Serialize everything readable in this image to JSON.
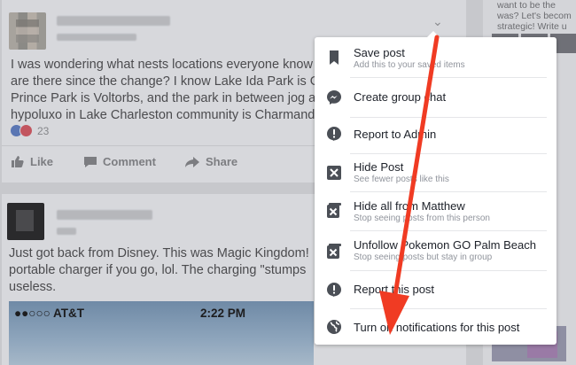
{
  "post1": {
    "text_lines": [
      "I was wondering what nests locations everyone know",
      "are there since the change? I know Lake Ida Park is G",
      "Prince Park is Voltorbs, and the park in between jog a",
      "hypoluxo in Lake Charleston community is Charmand"
    ],
    "reaction_count": "23",
    "actions": {
      "like": "Like",
      "comment": "Comment",
      "share": "Share"
    }
  },
  "post2": {
    "text_lines": [
      "Just got back from Disney. This was Magic Kingdom!",
      "portable charger if you go, lol. The charging \"stumps",
      "useless."
    ],
    "phone_status": {
      "carrier": "●●○○○ AT&T",
      "time": "2:22 PM"
    }
  },
  "rail": {
    "text_lines": [
      "want to be the",
      "was? Let's becom",
      "strategic! Write u"
    ]
  },
  "menu": {
    "items": [
      {
        "title": "Save post",
        "subtitle": "Add this to your saved items",
        "icon": "bookmark-icon"
      },
      {
        "title": "Create group chat",
        "subtitle": "",
        "icon": "messenger-icon"
      },
      {
        "title": "Report to Admin",
        "subtitle": "",
        "icon": "alert-icon"
      },
      {
        "title": "Hide Post",
        "subtitle": "See fewer posts like this",
        "icon": "hide-icon"
      },
      {
        "title": "Hide all from Matthew",
        "subtitle": "Stop seeing posts from this person",
        "icon": "hide-all-icon"
      },
      {
        "title": "Unfollow Pokemon GO Palm Beach",
        "subtitle": "Stop seeing posts but stay in group",
        "icon": "unfollow-icon"
      },
      {
        "title": "Report this post",
        "subtitle": "",
        "icon": "report-icon"
      },
      {
        "title": "Turn on notifications for this post",
        "subtitle": "",
        "icon": "globe-icon"
      }
    ]
  },
  "colors": {
    "annotation_arrow": "#f03b23",
    "menu_icon": "#4b4f56"
  }
}
